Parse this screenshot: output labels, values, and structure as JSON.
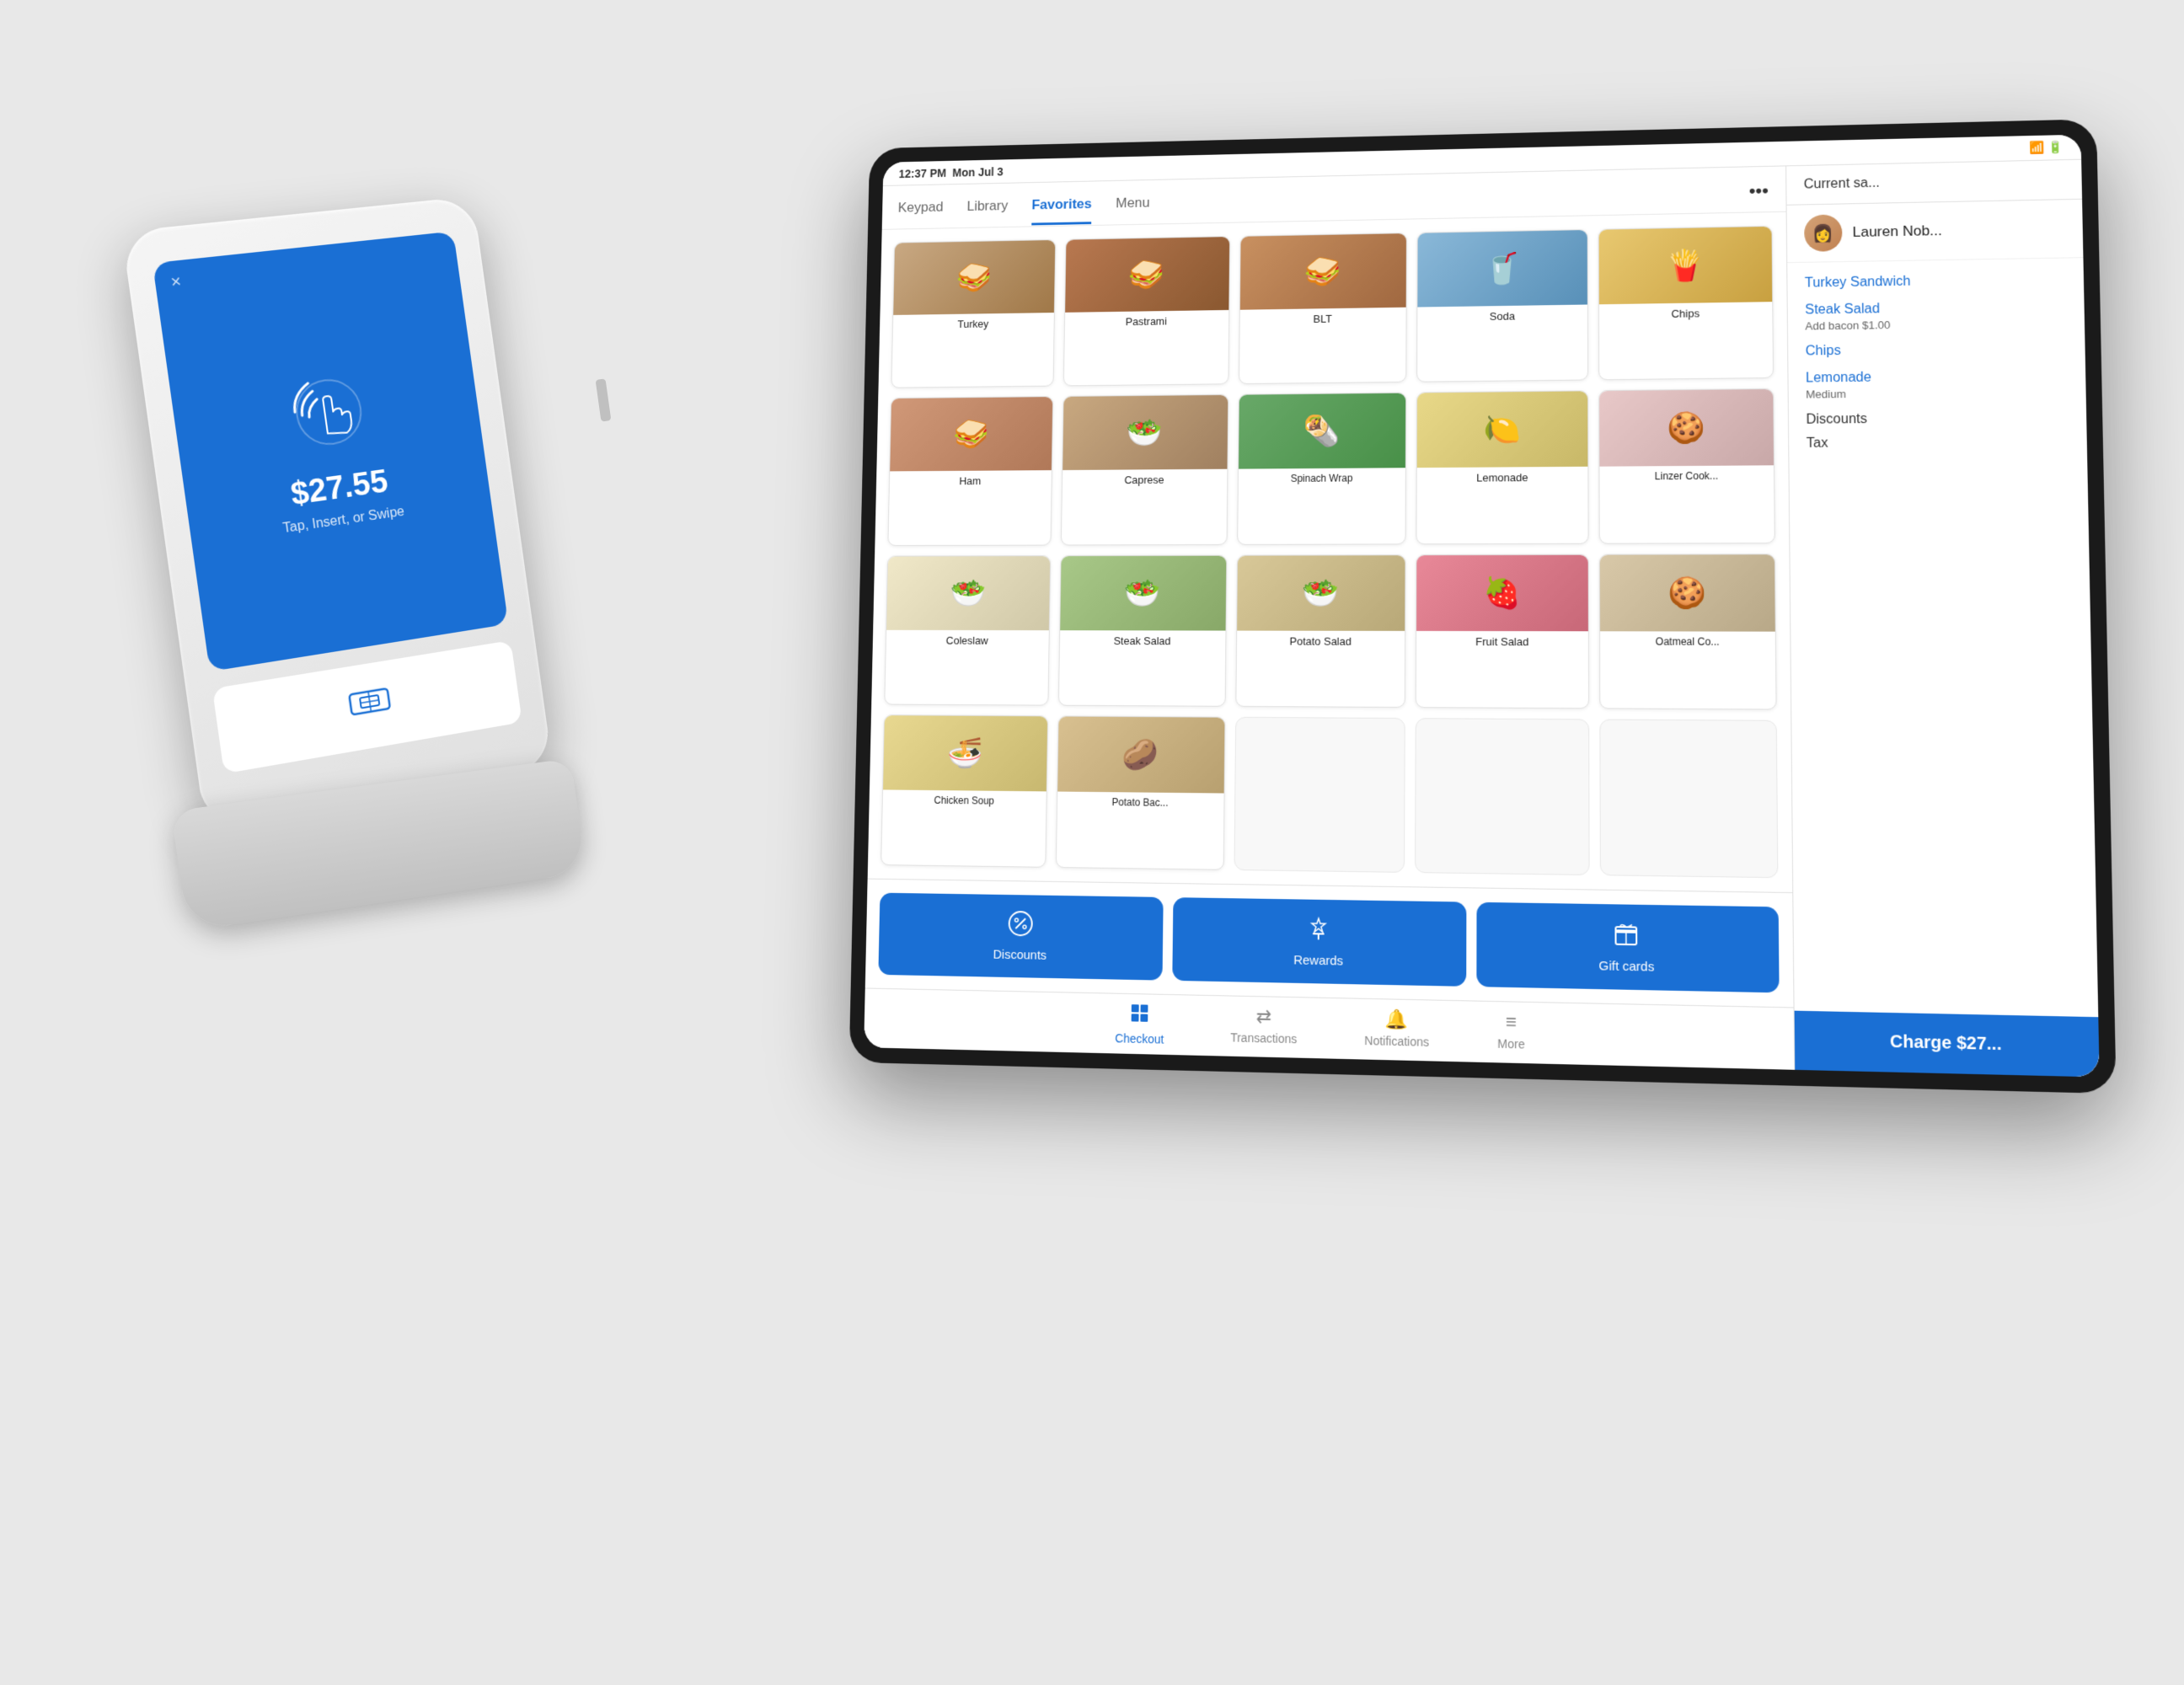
{
  "scene": {
    "background": "#e8e8e8"
  },
  "card_reader": {
    "amount": "$27.55",
    "subtitle": "Tap, Insert, or Swipe",
    "close_label": "×"
  },
  "tablet": {
    "status_bar": {
      "time": "12:37 PM",
      "date": "Mon Jul 3"
    },
    "tabs": [
      {
        "label": "Keypad",
        "active": false
      },
      {
        "label": "Library",
        "active": false
      },
      {
        "label": "Favorites",
        "active": true
      },
      {
        "label": "Menu",
        "active": false
      }
    ],
    "menu_items": [
      {
        "label": "Turkey",
        "emoji": "🥪",
        "color_class": "food-turkey"
      },
      {
        "label": "Pastrami",
        "emoji": "🥪",
        "color_class": "food-pastrami"
      },
      {
        "label": "BLT",
        "emoji": "🥪",
        "color_class": "food-blt"
      },
      {
        "label": "Soda",
        "emoji": "🥤",
        "color_class": "food-soda"
      },
      {
        "label": "Chips",
        "emoji": "🍟",
        "color_class": "food-chips"
      },
      {
        "label": "Ham",
        "emoji": "🥪",
        "color_class": "food-ham"
      },
      {
        "label": "Caprese",
        "emoji": "🥗",
        "color_class": "food-caprese"
      },
      {
        "label": "Spinach Wrap",
        "emoji": "🌯",
        "color_class": "food-spinach"
      },
      {
        "label": "Lemonade",
        "emoji": "🍋",
        "color_class": "food-lemonade"
      },
      {
        "label": "Linzer Cook...",
        "emoji": "🍪",
        "color_class": "food-linzer"
      },
      {
        "label": "Coleslaw",
        "emoji": "🥗",
        "color_class": "food-coleslaw"
      },
      {
        "label": "Steak Salad",
        "emoji": "🥗",
        "color_class": "food-steak-salad"
      },
      {
        "label": "Potato Salad",
        "emoji": "🥗",
        "color_class": "food-potato-salad"
      },
      {
        "label": "Fruit Salad",
        "emoji": "🍓",
        "color_class": "food-fruit-salad"
      },
      {
        "label": "Oatmeal Co...",
        "emoji": "🍪",
        "color_class": "food-oatmeal"
      },
      {
        "label": "Chicken Soup",
        "emoji": "🍜",
        "color_class": "food-chicken-soup"
      },
      {
        "label": "Potato Bac...",
        "emoji": "🥔",
        "color_class": "food-potato-bac"
      }
    ],
    "action_buttons": [
      {
        "label": "Discounts",
        "icon": "%"
      },
      {
        "label": "Rewards",
        "icon": "★"
      },
      {
        "label": "Gift cards",
        "icon": "🎁"
      }
    ],
    "bottom_nav": [
      {
        "label": "Checkout",
        "icon": "⊞",
        "active": true
      },
      {
        "label": "Transactions",
        "icon": "⇄",
        "active": false
      },
      {
        "label": "Notifications",
        "icon": "🔔",
        "active": false
      },
      {
        "label": "More",
        "icon": "≡",
        "active": false
      }
    ],
    "right_panel": {
      "header": "Current sa...",
      "customer_name": "Lauren Nob...",
      "order_items": [
        {
          "name": "Turkey Sandwich",
          "detail": ""
        },
        {
          "name": "Steak Salad",
          "detail": "Add bacon $1.00"
        },
        {
          "name": "Chips",
          "detail": ""
        },
        {
          "name": "Lemonade",
          "detail": "Medium"
        }
      ],
      "discounts_label": "Discounts",
      "tax_label": "Tax",
      "charge_label": "Charge $27..."
    }
  }
}
